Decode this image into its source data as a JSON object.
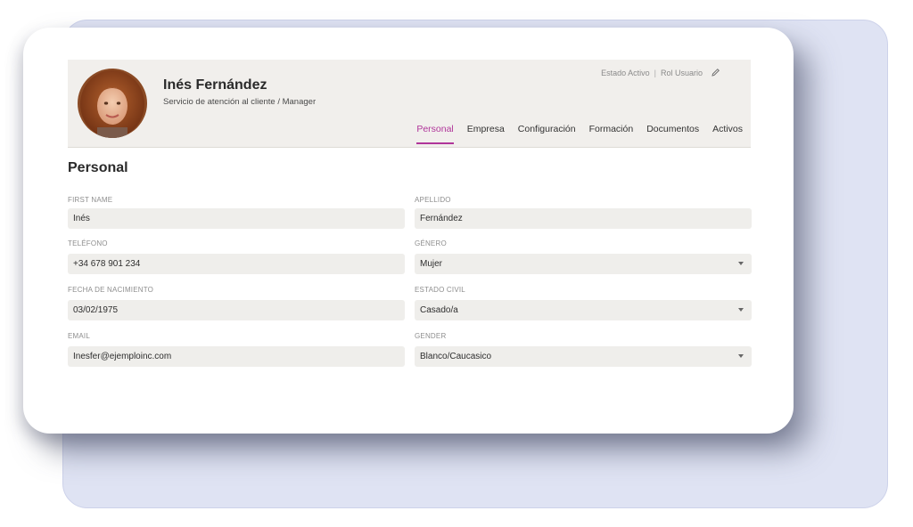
{
  "profile": {
    "name": "Inés Fernández",
    "department": "Servicio de atención al cliente /",
    "title": "Manager",
    "status": "Estado Activo",
    "status_separator": "|",
    "role": "Rol Usuario"
  },
  "tabs": [
    {
      "label": "Personal",
      "active": true
    },
    {
      "label": "Empresa"
    },
    {
      "label": "Configuración"
    },
    {
      "label": "Formación"
    },
    {
      "label": "Documentos"
    },
    {
      "label": "Activos"
    }
  ],
  "section": {
    "title": "Personal"
  },
  "fields": {
    "first_name": {
      "label": "FIRST NAME",
      "value": "Inés"
    },
    "apellido": {
      "label": "APELLIDO",
      "value": "Fernández"
    },
    "telefono": {
      "label": "TELÉFONO",
      "value": "+34 678 901 234"
    },
    "genero": {
      "label": "GÉNERO",
      "value": "Mujer"
    },
    "fecha": {
      "label": "FECHA DE NACIMIENTO",
      "value": "03/02/1975"
    },
    "estado_civil": {
      "label": "ESTADO CIVIL",
      "value": "Casado/a"
    },
    "email": {
      "label": "EMAIL",
      "value": "Inesfer@ejemploinc.com"
    },
    "gender": {
      "label": "GENDER",
      "value": "Blanco/Caucasico"
    }
  },
  "colors": {
    "accent": "#b0359a",
    "header_bg": "#f1efec",
    "field_bg": "#efeeeb",
    "back_card": "#dfe3f3"
  },
  "icons": {
    "edit": "pencil-icon",
    "avatar": "user-photo"
  }
}
